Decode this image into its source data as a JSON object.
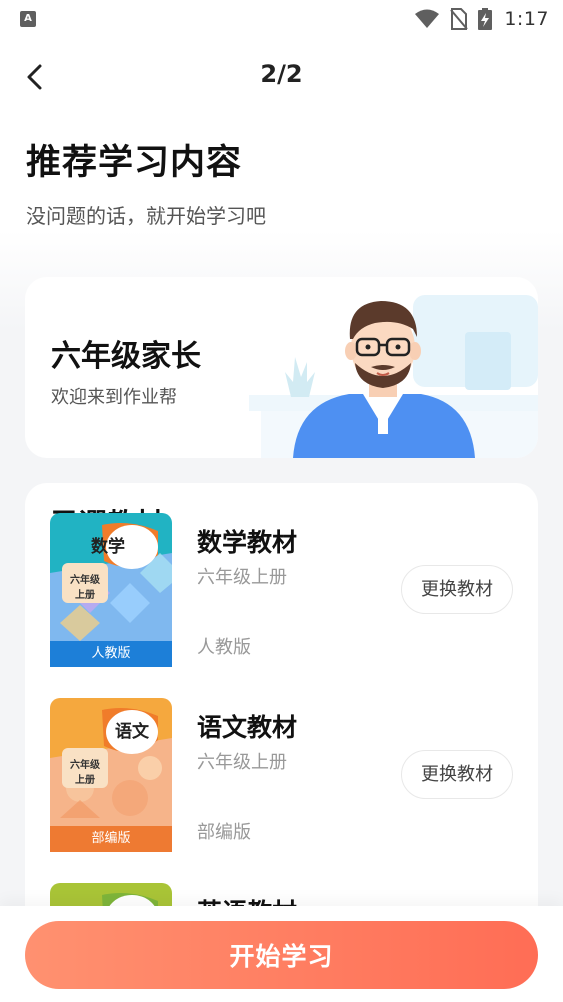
{
  "status_bar": {
    "time": "1:17",
    "left_icon_letter": "A",
    "icons": [
      "app-notification-icon",
      "wifi-icon",
      "no-sim-icon",
      "battery-charging-icon"
    ]
  },
  "header": {
    "page_indicator": "2/2",
    "back_icon": "chevron-left-icon"
  },
  "title": "推荐学习内容",
  "subtitle": "没问题的话，就开始学习吧",
  "profile": {
    "name": "六年级家长",
    "greeting": "欢迎来到作业帮"
  },
  "textbooks": {
    "heading": "已選教材",
    "items": [
      {
        "name": "数学教材",
        "grade": "六年级上册",
        "edition": "人教版",
        "change_label": "更换教材",
        "cover_subject": "数学",
        "cover_grade_line1": "六年级",
        "cover_grade_line2": "上册",
        "cover_colors": {
          "top": "#1aa9b8",
          "bottom": "#2c8fe0",
          "band": "#1f7fd6"
        }
      },
      {
        "name": "语文教材",
        "grade": "六年级上册",
        "edition": "部编版",
        "change_label": "更换教材",
        "cover_subject": "语文",
        "cover_grade_line1": "六年级",
        "cover_grade_line2": "上册",
        "cover_colors": {
          "top": "#f6a640",
          "bottom": "#f7895a",
          "band": "#ee7a32"
        }
      },
      {
        "name": "英语教材",
        "cover_colors": {
          "top": "#a9c437",
          "bottom": "#7eb53a",
          "band": "#6fa52f"
        }
      }
    ]
  },
  "start_button_label": "开始学习",
  "colors": {
    "accent_start": "#ff9170",
    "accent_end": "#ff6d55",
    "card_bg": "#ffffff",
    "page_bg": "#f4f5f7"
  }
}
